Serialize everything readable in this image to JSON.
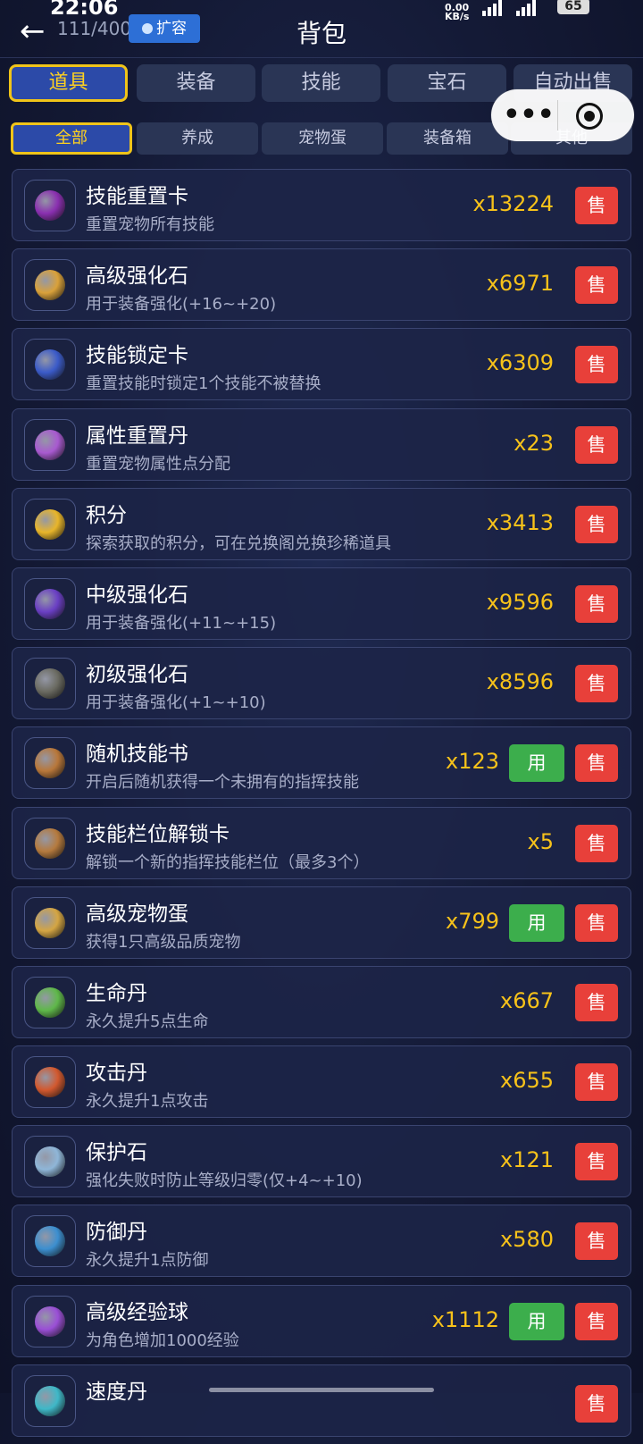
{
  "status": {
    "time": "22:06",
    "net_speed": "0.00",
    "net_unit": "KB/s",
    "battery": "65"
  },
  "header": {
    "capacity": "111/400",
    "expand_label": "扩容",
    "title": "背包"
  },
  "tabs": [
    "道具",
    "装备",
    "技能",
    "宝石",
    "自动出售"
  ],
  "subtabs": [
    "全部",
    "养成",
    "宠物蛋",
    "装备箱",
    "其他"
  ],
  "items": [
    {
      "name": "技能重置卡",
      "desc": "重置宠物所有技能",
      "qty": "x13224",
      "use": false,
      "color": "#8a2fb0"
    },
    {
      "name": "高级强化石",
      "desc": "用于装备强化(+16~+20)",
      "qty": "x6971",
      "use": false,
      "color": "#d9a13a"
    },
    {
      "name": "技能锁定卡",
      "desc": "重置技能时锁定1个技能不被替换",
      "qty": "x6309",
      "use": false,
      "color": "#3b5bc9"
    },
    {
      "name": "属性重置丹",
      "desc": "重置宠物属性点分配",
      "qty": "x23",
      "use": false,
      "color": "#a85ad0"
    },
    {
      "name": "积分",
      "desc": "探索获取的积分，可在兑换阁兑换珍稀道具",
      "qty": "x3413",
      "use": false,
      "color": "#e8b52a"
    },
    {
      "name": "中级强化石",
      "desc": "用于装备强化(+11~+15)",
      "qty": "x9596",
      "use": false,
      "color": "#6a3fc4"
    },
    {
      "name": "初级强化石",
      "desc": "用于装备强化(+1~+10)",
      "qty": "x8596",
      "use": false,
      "color": "#6b6b62"
    },
    {
      "name": "随机技能书",
      "desc": "开启后随机获得一个未拥有的指挥技能",
      "qty": "x123",
      "use": true,
      "color": "#b8773a"
    },
    {
      "name": "技能栏位解锁卡",
      "desc": "解锁一个新的指挥技能栏位（最多3个）",
      "qty": "x5",
      "use": false,
      "color": "#b57a3e"
    },
    {
      "name": "高级宠物蛋",
      "desc": "获得1只高级品质宠物",
      "qty": "x799",
      "use": true,
      "color": "#d4a543"
    },
    {
      "name": "生命丹",
      "desc": "永久提升5点生命",
      "qty": "x667",
      "use": false,
      "color": "#5fb84a"
    },
    {
      "name": "攻击丹",
      "desc": "永久提升1点攻击",
      "qty": "x655",
      "use": false,
      "color": "#d2592f"
    },
    {
      "name": "保护石",
      "desc": "强化失败时防止等级归零(仅+4~+10)",
      "qty": "x121",
      "use": false,
      "color": "#8fb6d8"
    },
    {
      "name": "防御丹",
      "desc": "永久提升1点防御",
      "qty": "x580",
      "use": false,
      "color": "#3c8fd0"
    },
    {
      "name": "高级经验球",
      "desc": "为角色增加1000经验",
      "qty": "x1112",
      "use": true,
      "color": "#9a4fd6"
    },
    {
      "name": "速度丹",
      "desc": "",
      "qty": "",
      "use": false,
      "color": "#3fb8c8"
    }
  ],
  "labels": {
    "use": "用",
    "sell": "售"
  }
}
